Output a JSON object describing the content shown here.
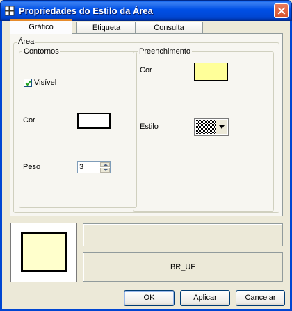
{
  "window": {
    "title": "Propriedades do Estilo da Área"
  },
  "tabs": [
    {
      "label": "Gráfico"
    },
    {
      "label": "Etiqueta"
    },
    {
      "label": "Consulta"
    }
  ],
  "area": {
    "legend": "Área",
    "contornos": {
      "legend": "Contornos",
      "visible_label": "Visível",
      "visible_checked": true,
      "cor_label": "Cor",
      "cor_value": "#ffffff",
      "peso_label": "Peso",
      "peso_value": "3"
    },
    "preenchimento": {
      "legend": "Preenchimento",
      "cor_label": "Cor",
      "cor_value": "#ffff99",
      "estilo_label": "Estilo",
      "estilo_icon": "checkered-pattern"
    }
  },
  "preview": {
    "fill_color": "#ffffcc",
    "border_color": "#000000"
  },
  "layer_name": "BR_UF",
  "buttons": {
    "ok": "OK",
    "apply": "Aplicar",
    "cancel": "Cancelar"
  }
}
